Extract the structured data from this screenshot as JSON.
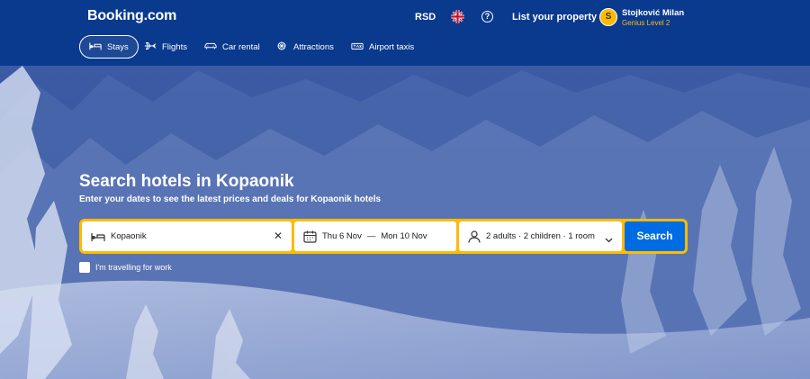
{
  "header": {
    "logo": "Booking.com",
    "currency": "RSD",
    "help": "?",
    "list_property": "List your property",
    "user": {
      "initial": "S",
      "name": "Stojković Milan",
      "level": "Genius Level 2"
    }
  },
  "nav": {
    "items": [
      {
        "label": "Stays",
        "icon": "bed-icon",
        "active": true
      },
      {
        "label": "Flights",
        "icon": "plane-icon",
        "active": false
      },
      {
        "label": "Car rental",
        "icon": "car-icon",
        "active": false
      },
      {
        "label": "Attractions",
        "icon": "attractions-icon",
        "active": false
      },
      {
        "label": "Airport taxis",
        "icon": "taxi-icon",
        "active": false
      }
    ]
  },
  "hero": {
    "title": "Search hotels in Kopaonik",
    "subtitle": "Enter your dates to see the latest prices and deals for Kopaonik hotels"
  },
  "search": {
    "destination": "Kopaonik",
    "check_in": "Thu 6 Nov",
    "check_out": "Mon 10 Nov",
    "date_separator": "—",
    "occupancy": "2 adults · 2 children · 1 room",
    "button": "Search",
    "work_travel": "I'm travelling for work"
  },
  "colors": {
    "header_bg": "#0a3a8e",
    "accent_yellow": "#febb02",
    "button_blue": "#006ce4"
  }
}
